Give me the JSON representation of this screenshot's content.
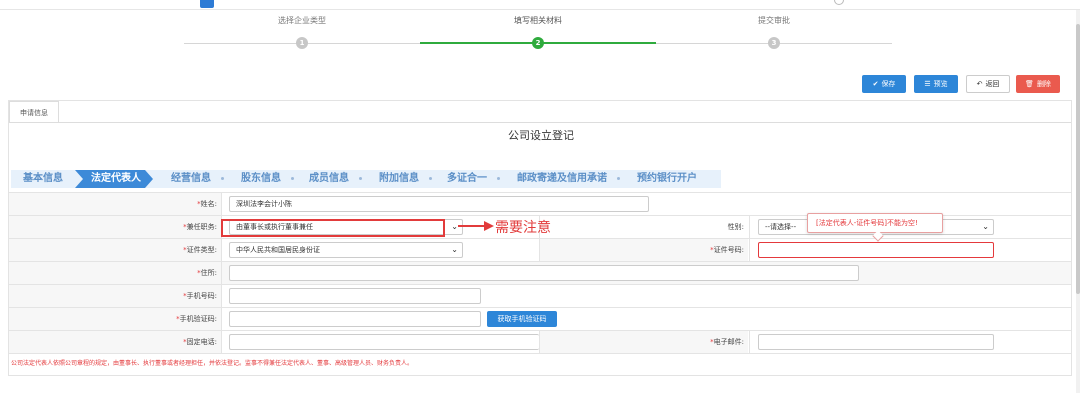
{
  "steps": [
    {
      "label": "选择企业类型",
      "number": "1",
      "state": "done"
    },
    {
      "label": "填写相关材料",
      "number": "2",
      "state": "active"
    },
    {
      "label": "提交审批",
      "number": "3",
      "state": "pending"
    }
  ],
  "toolbar": {
    "save_label": "保存",
    "preview_label": "预览",
    "back_label": "返回",
    "delete_label": "删除"
  },
  "panel": {
    "tab_label": "申请信息",
    "form_title": "公司设立登记"
  },
  "section_tabs": [
    "基本信息",
    "法定代表人",
    "经营信息",
    "股东信息",
    "成员信息",
    "附加信息",
    "多证合一",
    "邮政寄递及信用承诺",
    "预约银行开户"
  ],
  "active_section": "法定代表人",
  "form": {
    "name": {
      "label": "姓名:",
      "value": "深圳法李会计小陈"
    },
    "position": {
      "label": "兼任职务:",
      "value": "由董事长或执行董事兼任"
    },
    "gender": {
      "label": "性别:",
      "value": "--请选择--"
    },
    "id_type": {
      "label": "证件类型:",
      "value": "中华人民共和国居民身份证"
    },
    "id_number": {
      "label": "证件号码:",
      "value": ""
    },
    "address": {
      "label": "住所:",
      "value": ""
    },
    "phone": {
      "label": "手机号码:",
      "value": ""
    },
    "sms_code": {
      "label": "手机验证码:",
      "value": "",
      "button_label": "获取手机验证码"
    },
    "landline": {
      "label": "固定电话:",
      "value": ""
    },
    "email": {
      "label": "电子邮件:",
      "value": ""
    }
  },
  "required_marker": "*",
  "footnote": "公司法定代表人依照公司章程的规定，由董事长、执行董事或者经理担任，并依法登记。监事不得兼任法定代表人、董事、高级管理人员、财务负责人。",
  "annotation_text": "需要注意",
  "tooltip_text": "[法定代表人-证件号码]不能为空!",
  "colors": {
    "primary": "#2d86d8",
    "success": "#2fab3d",
    "danger": "#ea5a4e",
    "error": "#e4393c"
  },
  "icons": {
    "save": "check-icon",
    "preview": "list-icon",
    "back": "undo-icon",
    "delete": "trash-icon"
  }
}
